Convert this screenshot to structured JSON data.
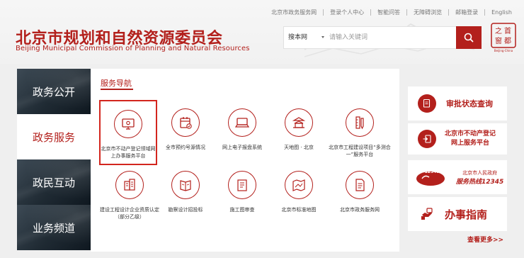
{
  "topbar": {
    "links": [
      "北京市政务服务网",
      "登录个人中心",
      "智能问答",
      "无障碍浏览",
      "邮箱登录",
      "English"
    ]
  },
  "logo": {
    "cn": "北京市规划和自然资源委员会",
    "en": "Beijing Municipal Commission of Planning and Natural Resources"
  },
  "search": {
    "scope": "搜本网",
    "placeholder": "请输入关键词"
  },
  "seal": {
    "chars": [
      "首",
      "都",
      "之",
      "窗"
    ],
    "caption": "Beijing·China"
  },
  "leftnav": {
    "items": [
      "政务公开",
      "政务服务",
      "政民互动",
      "业务频道"
    ],
    "active_index": 1
  },
  "main": {
    "title": "服务导航",
    "services": [
      {
        "label": "北京市不动产登记领域网上办事服务平台",
        "icon": "computer-icon",
        "selected": true
      },
      {
        "label": "全市预约号源情况",
        "icon": "calendar-check-icon"
      },
      {
        "label": "网上电子报盘系统",
        "icon": "laptop-icon"
      },
      {
        "label": "天地图 · 北京",
        "icon": "temple-icon"
      },
      {
        "label": "北京市工程建设项目“多测合一”服务平台",
        "icon": "ruler-pencil-icon"
      },
      {
        "label": "建设工程设计企业资质认定（部分乙级）",
        "icon": "buildings-icon"
      },
      {
        "label": "勘察设计招投标",
        "icon": "book-icon"
      },
      {
        "label": "施工图审查",
        "icon": "blueprint-icon"
      },
      {
        "label": "北京市标准地图",
        "icon": "map-icon"
      },
      {
        "label": "北京市政务服务网",
        "icon": "document-icon"
      }
    ]
  },
  "right": {
    "status_query": "审批状态查询",
    "realty_line1": "北京市不动产登记",
    "realty_line2": "网上服务平台",
    "hotline_label": "北京市人民政府",
    "hotline_badge": "12345",
    "hotline_text": "服务热线12345",
    "guide": "办事指南",
    "more": "查看更多>>"
  },
  "colors": {
    "brand_red": "#b3201c",
    "dark_nav": "#1f2a33"
  }
}
